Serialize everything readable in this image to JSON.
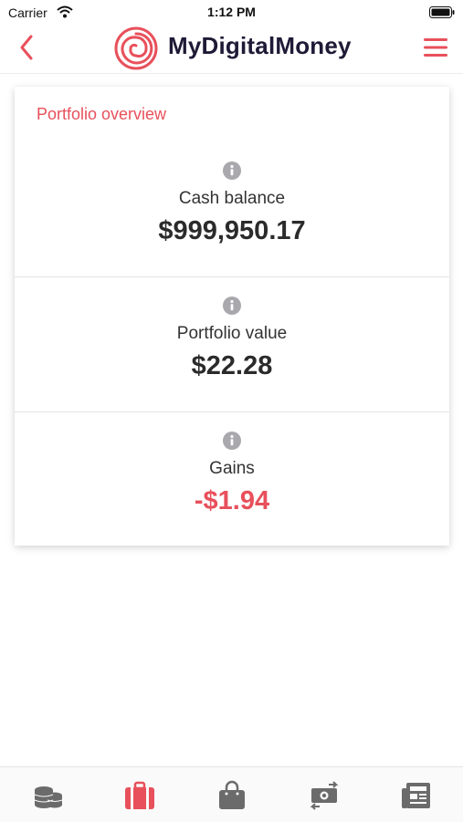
{
  "status_bar": {
    "carrier": "Carrier",
    "time": "1:12 PM"
  },
  "header": {
    "title": "MyDigitalMoney",
    "accent_color": "#e8505b",
    "title_color": "#1f1a36",
    "icons": {
      "back": "chevron-left-icon",
      "logo": "spiral-logo-icon",
      "menu": "hamburger-menu-icon"
    }
  },
  "portfolio": {
    "title": "Portfolio overview",
    "metrics": [
      {
        "label": "Cash balance",
        "value": "$999,950.17",
        "negative": false
      },
      {
        "label": "Portfolio value",
        "value": "$22.28",
        "negative": false
      },
      {
        "label": "Gains",
        "value": "-$1.94",
        "negative": true
      }
    ]
  },
  "tab_bar": {
    "active_index": 1,
    "active_color": "#e8505b",
    "inactive_color": "#6b6b6b",
    "tabs": [
      {
        "icon": "coins-icon"
      },
      {
        "icon": "briefcase-icon"
      },
      {
        "icon": "shopping-bag-icon"
      },
      {
        "icon": "money-exchange-icon"
      },
      {
        "icon": "newspaper-icon"
      }
    ]
  }
}
